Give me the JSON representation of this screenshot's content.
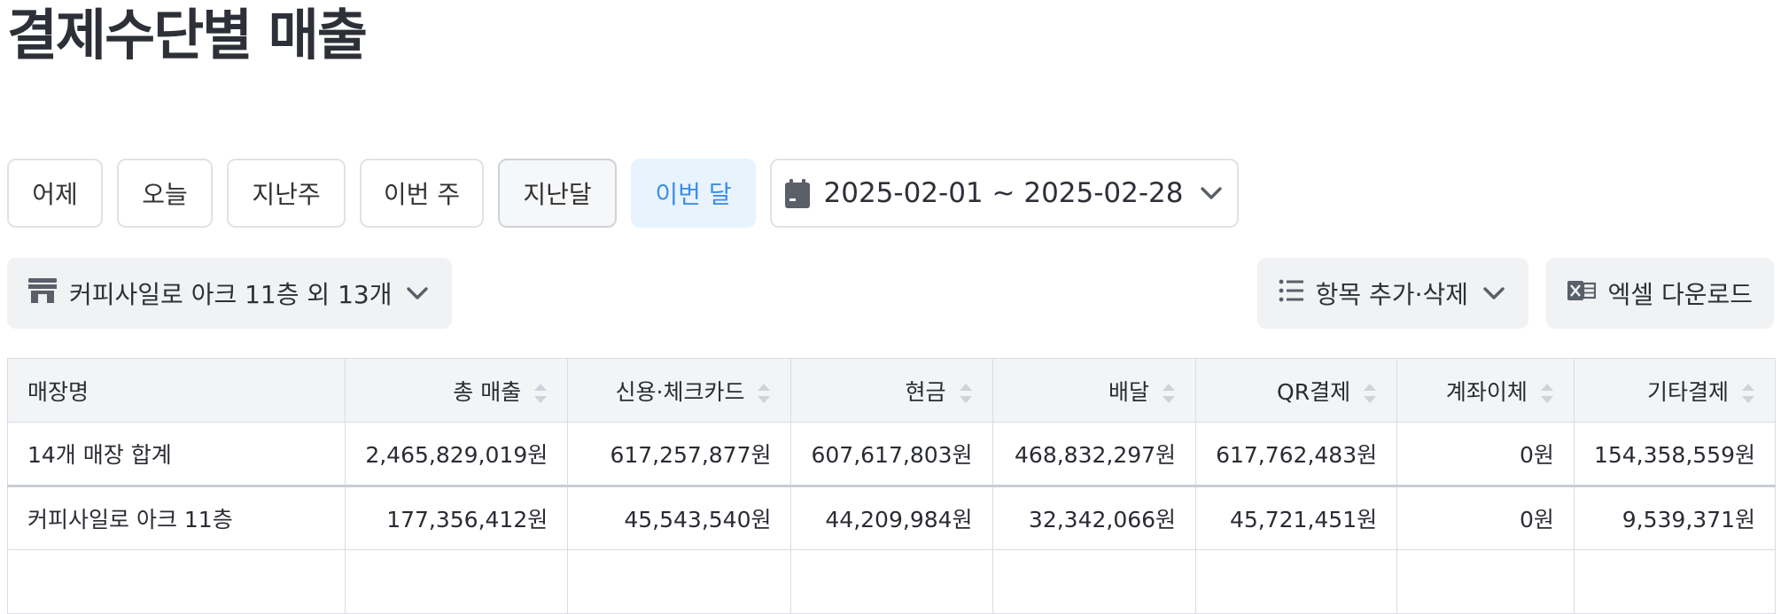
{
  "page": {
    "title": "결제수단별 매출"
  },
  "period_buttons": [
    "어제",
    "오늘",
    "지난주",
    "이번 주",
    "지난달",
    "이번 달"
  ],
  "period_selected": "이번 달",
  "date_range": "2025-02-01 ~ 2025-02-28",
  "store_filter": {
    "label": "커피사일로 아크 11층 외 13개"
  },
  "column_config": {
    "label": "항목 추가·삭제"
  },
  "excel_download": {
    "label": "엑셀 다운로드"
  },
  "table": {
    "columns": [
      "매장명",
      "총 매출",
      "신용·체크카드",
      "현금",
      "배달",
      "QR결제",
      "계좌이체",
      "기타결제"
    ],
    "rows": [
      [
        "14개 매장 합계",
        "2,465,829,019원",
        "617,257,877원",
        "607,617,803원",
        "468,832,297원",
        "617,762,483원",
        "0원",
        "154,358,559원"
      ],
      [
        "커피사일로 아크 11층",
        "177,356,412원",
        "45,543,540원",
        "44,209,984원",
        "32,342,066원",
        "45,721,451원",
        "0원",
        "9,539,371원"
      ],
      [
        "",
        "",
        "",
        "",
        "",
        "",
        "",
        ""
      ]
    ]
  },
  "colors": {
    "accent": "#3d8ee6",
    "accent_bg": "#e8f3fe",
    "header_bg": "#f2f4f6",
    "border": "#d9dce1"
  }
}
